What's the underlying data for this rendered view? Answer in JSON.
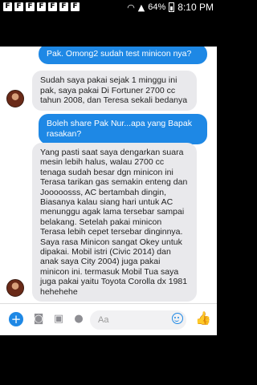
{
  "status_bar": {
    "notification_icons": [
      "F",
      "F",
      "F",
      "F",
      "F",
      "F",
      "F"
    ],
    "battery": "64%",
    "time": "8:10 PM"
  },
  "messages": [
    {
      "direction": "out",
      "text": "Pak. Omong2 sudah test minicon nya?"
    },
    {
      "direction": "in",
      "text": "Sudah saya pakai sejak 1 minggu ini pak,  saya pakai Di Fortuner 2700 cc tahun 2008,  dan Teresa sekali bedanya"
    },
    {
      "direction": "out",
      "text": "Boleh share Pak Nur...apa yang Bapak rasakan?"
    },
    {
      "direction": "in",
      "text": "Yang pasti saat saya dengarkan suara mesin lebih halus,  walau 2700 cc tenaga sudah besar dgn minicon ini Terasa tarikan gas semakin enteng dan Jooooosss,  AC bertambah dingin, Biasanya kalau siang hari untuk AC menunggu agak lama tersebar sampai belakang. Setelah pakai minicon Terasa lebih cepet tersebar dinginnya. Saya rasa Minicon sangat Okey untuk dipakai. Mobil istri (Civic 2014) dan anak saya City 2004) juga pakai minicon ini. termasuk Mobil Tua saya juga pakai yaitu Toyota Corolla dx 1981 hehehehe"
    }
  ],
  "composer": {
    "placeholder": "Aa",
    "icons": [
      "plus-icon",
      "camera-icon",
      "gallery-icon",
      "microphone-icon",
      "emoji-icon",
      "like-icon"
    ]
  },
  "colors": {
    "accent": "#1e88e5",
    "incoming_bubble": "#e9e9ec",
    "background": "#ffffff"
  }
}
